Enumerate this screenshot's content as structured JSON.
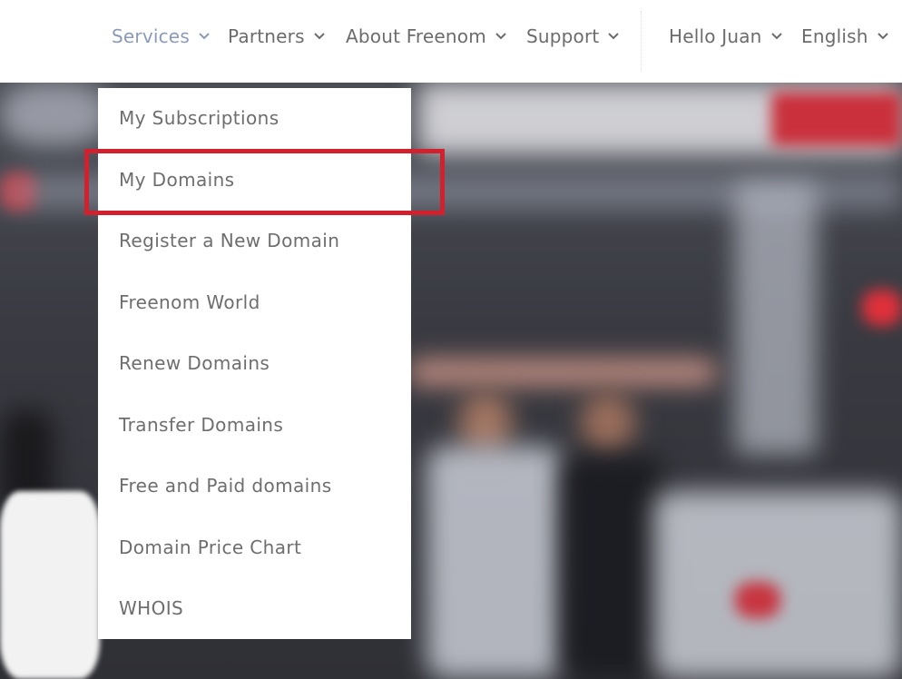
{
  "nav": {
    "services_label": "Services",
    "partners_label": "Partners",
    "about_label": "About Freenom",
    "support_label": "Support",
    "user_label": "Hello Juan",
    "language_label": "English"
  },
  "dropdown": {
    "items": [
      "My Subscriptions",
      "My Domains",
      "Register a New Domain",
      "Freenom World",
      "Renew Domains",
      "Transfer Domains",
      "Free and Paid domains",
      "Domain Price Chart",
      "WHOIS"
    ],
    "highlighted_item": "My Domains"
  },
  "colors": {
    "active_nav": "#8b9ab8",
    "nav_text": "#6c6c6c",
    "highlight_border": "#d1202e",
    "menu_bg": "#ffffff"
  },
  "icons": {
    "nav_chevron": "chevron-down-icon"
  }
}
